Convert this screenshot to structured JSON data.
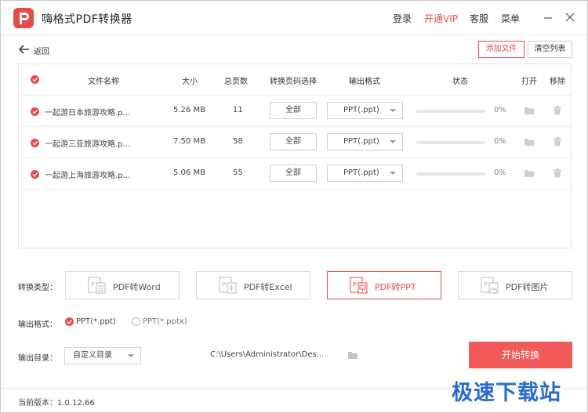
{
  "app": {
    "title": "嗨格式PDF转换器"
  },
  "nav": {
    "login": "登录",
    "vip": "开通VIP",
    "service": "客服",
    "menu": "菜单"
  },
  "toolbar": {
    "back": "返回",
    "add_file": "添加文件",
    "clear_list": "清空列表"
  },
  "table": {
    "headers": {
      "name": "文件名称",
      "size": "大小",
      "pages": "总页数",
      "page_select": "转换页码选择",
      "format": "输出格式",
      "status": "状态",
      "open": "打开",
      "remove": "移除"
    },
    "rows": [
      {
        "name": "一起游日本旅游攻略.p...",
        "size": "5.26 MB",
        "pages": "11",
        "page_select": "全部",
        "format": "PPT(.ppt)",
        "progress": "0%"
      },
      {
        "name": "一起游三亚旅游攻略.p...",
        "size": "7.50 MB",
        "pages": "58",
        "page_select": "全部",
        "format": "PPT(.ppt)",
        "progress": "0%"
      },
      {
        "name": "一起游上海旅游攻略.p...",
        "size": "5.06 MB",
        "pages": "55",
        "page_select": "全部",
        "format": "PPT(.ppt)",
        "progress": "0%"
      }
    ]
  },
  "convert": {
    "type_label": "转换类型：",
    "types": [
      {
        "label": "PDF转Word",
        "active": false
      },
      {
        "label": "PDF转Excel",
        "active": false
      },
      {
        "label": "PDF转PPT",
        "active": true
      },
      {
        "label": "PDF转图片",
        "active": false
      }
    ],
    "format_label": "输出格式：",
    "formats": [
      {
        "label": "PPT(*.ppt)",
        "selected": true
      },
      {
        "label": "PPT(*.pptx)",
        "selected": false
      }
    ],
    "dir_label": "输出目录：",
    "dir_option": "自定义目录",
    "dir_path": "C:\\Users\\Administrator\\Des...",
    "start": "开始转换"
  },
  "footer": {
    "version": "当前版本：1.0.12.66"
  },
  "watermark": "极速下载站",
  "colors": {
    "accent": "#e94b4b",
    "button": "#f25a5a"
  }
}
